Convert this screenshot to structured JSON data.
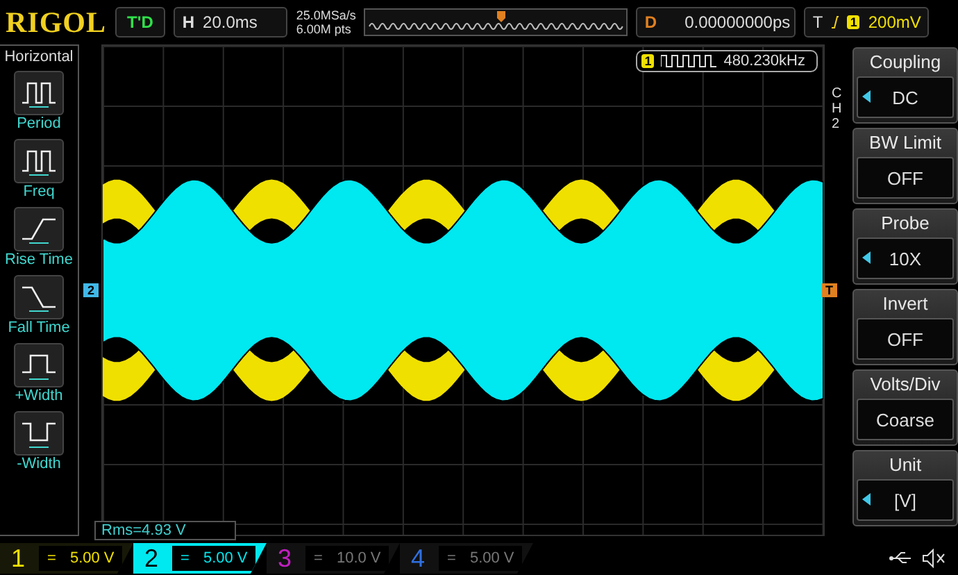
{
  "top_bar": {
    "logo": "RIGOL",
    "run_status": "T'D",
    "timebase_label": "H",
    "timebase": "20.0ms",
    "sample_rate": "25.0MSa/s",
    "memory_depth": "6.00M pts",
    "delay_label": "D",
    "delay": "0.00000000ps",
    "trigger_label": "T",
    "trigger_source": "1",
    "trigger_level": "200mV"
  },
  "left_menu": {
    "title": "Horizontal",
    "items": [
      {
        "label": "Period",
        "kind": "period"
      },
      {
        "label": "Freq",
        "kind": "freq"
      },
      {
        "label": "Rise Time",
        "kind": "rise"
      },
      {
        "label": "Fall Time",
        "kind": "fall"
      },
      {
        "label": "+Width",
        "kind": "pwidth"
      },
      {
        "label": "-Width",
        "kind": "nwidth"
      }
    ]
  },
  "display": {
    "channel_marker": "2",
    "trigger_marker": "T",
    "frequency_source": "1",
    "frequency": "480.230kHz",
    "measurement": "Rms=4.93 V"
  },
  "right_menu": {
    "channel": "CH2",
    "items": [
      {
        "title": "Coupling",
        "value": "DC",
        "switchable": true
      },
      {
        "title": "BW Limit",
        "value": "OFF",
        "switchable": false
      },
      {
        "title": "Probe",
        "value": "10X",
        "switchable": true
      },
      {
        "title": "Invert",
        "value": "OFF",
        "switchable": false
      },
      {
        "title": "Volts/Div",
        "value": "Coarse",
        "switchable": false
      },
      {
        "title": "Unit",
        "value": "[V]",
        "switchable": true
      }
    ]
  },
  "channels": [
    {
      "number": "1",
      "coupling": "=",
      "scale": "5.00 V",
      "color": "#f0e000",
      "enabled": true,
      "selected": false
    },
    {
      "number": "2",
      "coupling": "=",
      "scale": "5.00 V",
      "color": "#00e8f0",
      "enabled": true,
      "selected": true
    },
    {
      "number": "3",
      "coupling": "=",
      "scale": "10.0 V",
      "color": "#c020c0",
      "enabled": false,
      "selected": false
    },
    {
      "number": "4",
      "coupling": "=",
      "scale": "5.00 V",
      "color": "#3070e0",
      "enabled": false,
      "selected": false
    }
  ]
}
